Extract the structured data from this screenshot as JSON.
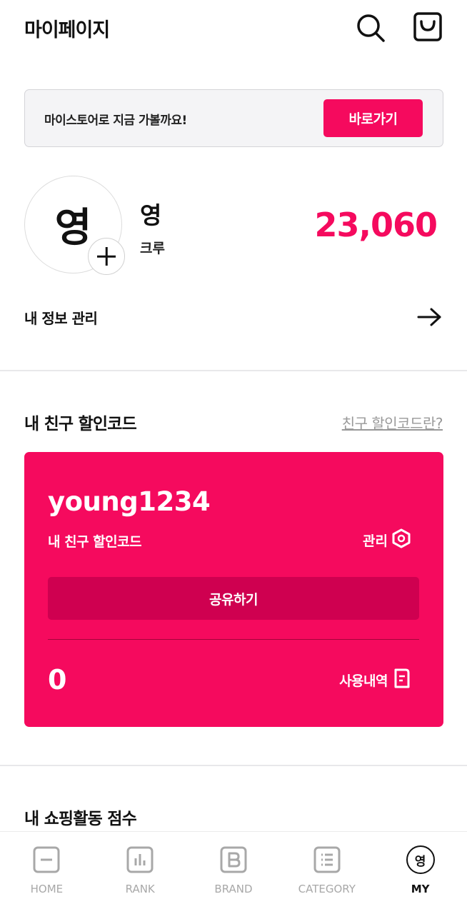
{
  "header": {
    "title": "마이페이지",
    "search_icon": "search-icon",
    "bag_icon": "shopping-bag-icon"
  },
  "banner": {
    "text": "마이스토어로 지금 가볼까요!",
    "button_label": "바로가기"
  },
  "profile": {
    "avatar_initial": "영",
    "name": "영",
    "grade": "크루",
    "points": "23,060",
    "add_icon": "plus-icon"
  },
  "my_info": {
    "label": "내 정보 관리",
    "icon": "arrow-right-icon"
  },
  "friend_code_section": {
    "title": "내 친구 할인코드",
    "info_link": "친구 할인코드란?",
    "card": {
      "code": "young1234",
      "label": "내 친구 할인코드",
      "manage_label": "관리",
      "manage_icon": "settings-hex-icon",
      "share_label": "공유하기",
      "use_count": "0",
      "history_label": "사용내역",
      "history_icon": "document-icon"
    }
  },
  "shopping_section": {
    "title": "내 쇼핑활동 점수"
  },
  "tabbar": {
    "tabs": [
      {
        "label": "HOME",
        "icon": "home-icon"
      },
      {
        "label": "RANK",
        "icon": "rank-chart-icon"
      },
      {
        "label": "BRAND",
        "icon": "brand-b-icon"
      },
      {
        "label": "CATEGORY",
        "icon": "category-list-icon"
      },
      {
        "label": "MY",
        "icon": "my-profile-icon",
        "badge": "영"
      }
    ],
    "active": "MY"
  },
  "colors": {
    "accent": "#f50a5e",
    "accent_dark": "#cf0050",
    "inactive_tab": "#a8a8a8"
  }
}
